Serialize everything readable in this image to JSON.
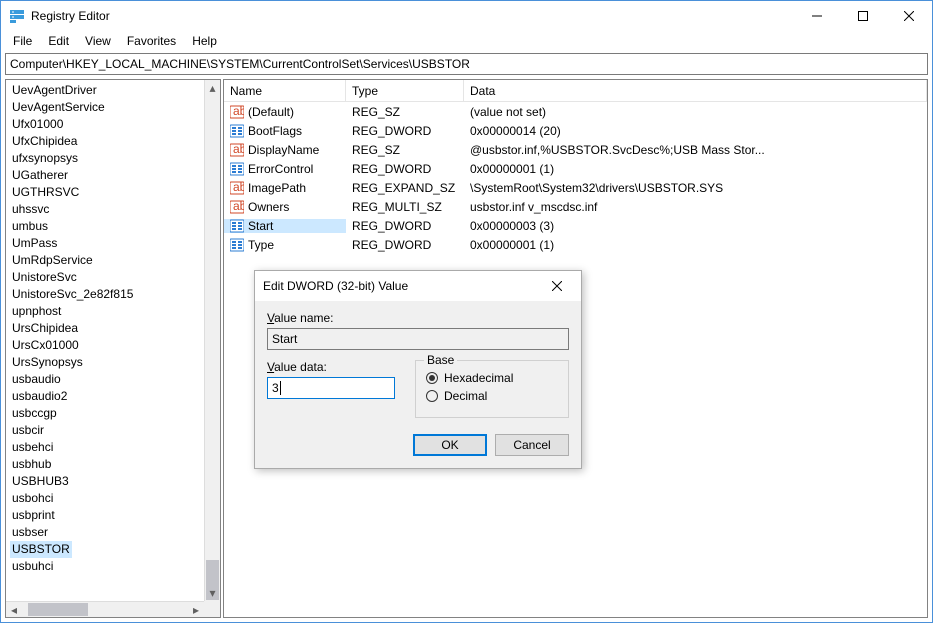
{
  "window": {
    "title": "Registry Editor"
  },
  "menu": {
    "file": "File",
    "edit": "Edit",
    "view": "View",
    "favorites": "Favorites",
    "help": "Help"
  },
  "address": {
    "path": "Computer\\HKEY_LOCAL_MACHINE\\SYSTEM\\CurrentControlSet\\Services\\USBSTOR"
  },
  "tree": {
    "items": [
      "UevAgentDriver",
      "UevAgentService",
      "Ufx01000",
      "UfxChipidea",
      "ufxsynopsys",
      "UGatherer",
      "UGTHRSVC",
      "uhssvc",
      "umbus",
      "UmPass",
      "UmRdpService",
      "UnistoreSvc",
      "UnistoreSvc_2e82f815",
      "upnphost",
      "UrsChipidea",
      "UrsCx01000",
      "UrsSynopsys",
      "usbaudio",
      "usbaudio2",
      "usbccgp",
      "usbcir",
      "usbehci",
      "usbhub",
      "USBHUB3",
      "usbohci",
      "usbprint",
      "usbser",
      "USBSTOR",
      "usbuhci"
    ],
    "selected": "USBSTOR"
  },
  "listview": {
    "headers": {
      "name": "Name",
      "type": "Type",
      "data": "Data"
    },
    "rows": [
      {
        "icon": "sz",
        "name": "(Default)",
        "type": "REG_SZ",
        "data": "(value not set)"
      },
      {
        "icon": "dw",
        "name": "BootFlags",
        "type": "REG_DWORD",
        "data": "0x00000014 (20)"
      },
      {
        "icon": "sz",
        "name": "DisplayName",
        "type": "REG_SZ",
        "data": "@usbstor.inf,%USBSTOR.SvcDesc%;USB Mass Stor..."
      },
      {
        "icon": "dw",
        "name": "ErrorControl",
        "type": "REG_DWORD",
        "data": "0x00000001 (1)"
      },
      {
        "icon": "sz",
        "name": "ImagePath",
        "type": "REG_EXPAND_SZ",
        "data": "\\SystemRoot\\System32\\drivers\\USBSTOR.SYS"
      },
      {
        "icon": "sz",
        "name": "Owners",
        "type": "REG_MULTI_SZ",
        "data": "usbstor.inf v_mscdsc.inf"
      },
      {
        "icon": "dw",
        "name": "Start",
        "type": "REG_DWORD",
        "data": "0x00000003 (3)",
        "selected": true
      },
      {
        "icon": "dw",
        "name": "Type",
        "type": "REG_DWORD",
        "data": "0x00000001 (1)"
      }
    ]
  },
  "dialog": {
    "title": "Edit DWORD (32-bit) Value",
    "value_name_label": "Value name:",
    "value_name": "Start",
    "value_data_label": "Value data:",
    "value_data": "3",
    "base_label": "Base",
    "hex_label": "Hexadecimal",
    "dec_label": "Decimal",
    "base_selected": "hex",
    "ok": "OK",
    "cancel": "Cancel"
  }
}
